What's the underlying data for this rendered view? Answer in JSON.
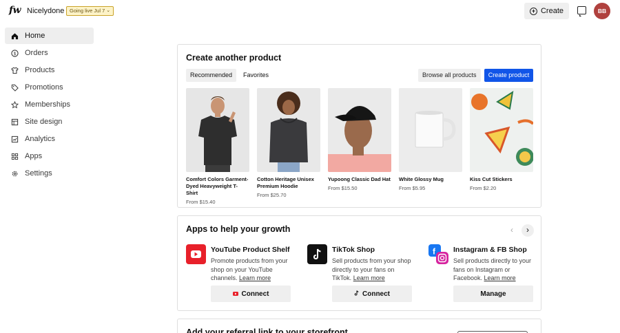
{
  "topbar": {
    "logo": "fw",
    "shop_name": "Nicelydone",
    "live_badge": "Going live Jul 7",
    "create_label": "Create",
    "avatar_initials": "BB",
    "avatar_color": "#b0413e"
  },
  "sidebar": {
    "items": [
      {
        "label": "Home",
        "icon": "home-icon"
      },
      {
        "label": "Orders",
        "icon": "dollar-circle-icon"
      },
      {
        "label": "Products",
        "icon": "shirt-icon"
      },
      {
        "label": "Promotions",
        "icon": "tag-icon"
      },
      {
        "label": "Memberships",
        "icon": "star-icon"
      },
      {
        "label": "Site design",
        "icon": "layout-icon"
      },
      {
        "label": "Analytics",
        "icon": "chart-icon"
      },
      {
        "label": "Apps",
        "icon": "grid-icon"
      },
      {
        "label": "Settings",
        "icon": "gear-icon"
      }
    ]
  },
  "create_product": {
    "title": "Create another product",
    "tabs": [
      "Recommended",
      "Favorites"
    ],
    "browse_label": "Browse all products",
    "create_label": "Create product",
    "accent": "#1155e8",
    "products": [
      {
        "name": "Comfort Colors Garment-Dyed Heavyweight T-Shirt",
        "price": "From $15.40"
      },
      {
        "name": "Cotton Heritage Unisex Premium Hoodie",
        "price": "From $25.70"
      },
      {
        "name": "Yupoong Classic Dad Hat",
        "price": "From $15.50"
      },
      {
        "name": "White Glossy Mug",
        "price": "From $5.95"
      },
      {
        "name": "Kiss Cut Stickers",
        "price": "From $2.20"
      }
    ]
  },
  "apps": {
    "title": "Apps to help your growth",
    "items": [
      {
        "title": "YouTube Product Shelf",
        "desc": "Promote products from your shop on your YouTube channels.",
        "learn": "Learn more",
        "button": "Connect"
      },
      {
        "title": "TikTok Shop",
        "desc": "Sell products from your shop directly to your fans on TikTok.",
        "learn": "Learn more",
        "button": "Connect"
      },
      {
        "title": "Instagram & FB Shop",
        "desc": "Sell products directly to your fans on Instagram or Facebook.",
        "learn": "Learn more",
        "button": "Manage"
      }
    ]
  },
  "referral": {
    "title": "Add your referral link to your storefront"
  }
}
